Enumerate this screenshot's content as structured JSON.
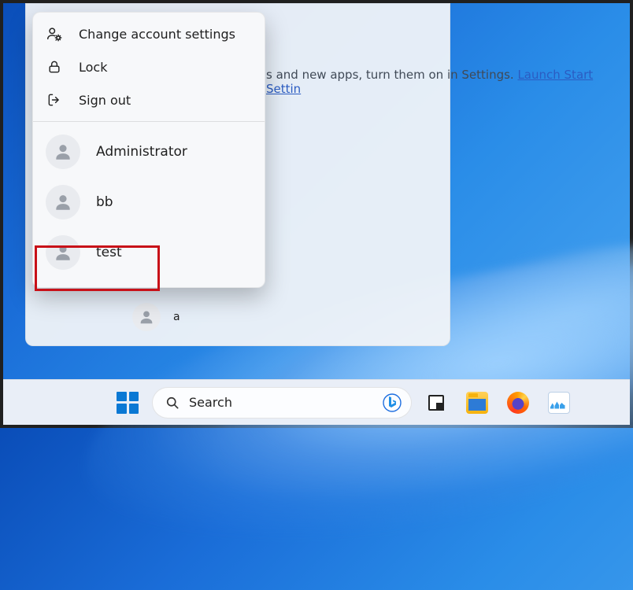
{
  "notice": {
    "text_fragment": "s and new apps, turn them on in Settings. ",
    "link": "Launch Start Settin"
  },
  "start_panel": {
    "user_label": "a"
  },
  "flyout": {
    "change_settings": "Change account settings",
    "lock": "Lock",
    "sign_out": "Sign out",
    "users": [
      {
        "label": "Administrator"
      },
      {
        "label": "bb"
      },
      {
        "label": "test"
      }
    ]
  },
  "taskbar": {
    "search_placeholder": "Search"
  }
}
